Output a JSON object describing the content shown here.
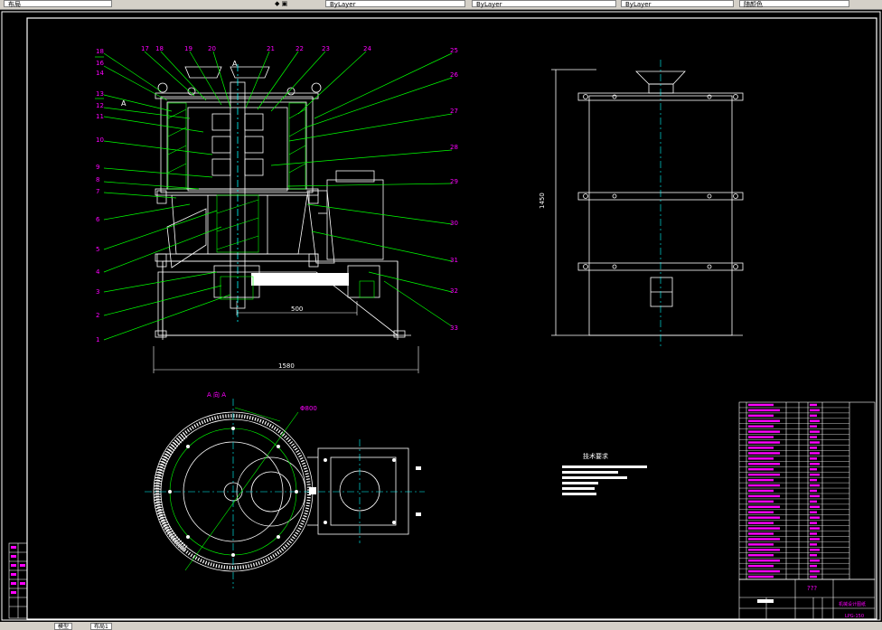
{
  "toolbar": {
    "left_label": "布局",
    "dropdowns": [
      "ByLayer",
      "ByLayer",
      "ByLayer",
      "随颜色"
    ]
  },
  "drawing": {
    "leaders_left": [
      "18",
      "16",
      "14",
      "13",
      "12",
      "11",
      "10",
      "9",
      "8",
      "7",
      "6",
      "5",
      "4",
      "3",
      "2",
      "1"
    ],
    "leaders_top": [
      "17",
      "18",
      "19",
      "20",
      "21",
      "22",
      "23",
      "24"
    ],
    "leaders_right": [
      "25",
      "26",
      "27",
      "28",
      "29",
      "30",
      "31",
      "32",
      "33"
    ],
    "section_marks": [
      "A",
      "A"
    ],
    "dim_overall_width": "1580",
    "dim_inner_width": "500",
    "dim_height": "1450",
    "plan_label": "A 向 A",
    "plan_dim": "Φ800",
    "tech_req_title": "技术要求",
    "title_block_name": "???",
    "title_block_drawing": "LPG-150",
    "title_block_school": "机械设计图纸"
  },
  "bottom_tabs": [
    "模型",
    "布局1"
  ],
  "colors": {
    "background": "#000000",
    "frame": "#ffffff",
    "leader": "#00ff00",
    "label": "#ff00ff",
    "center": "#00ffff",
    "hatch": "#00ff00"
  }
}
